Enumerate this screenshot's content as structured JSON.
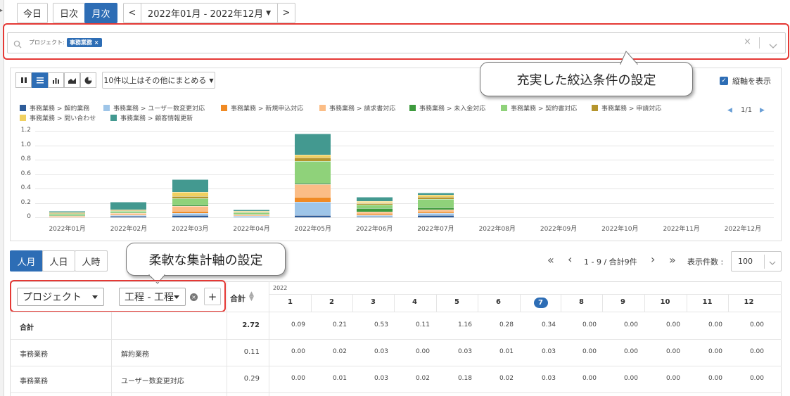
{
  "nav": {
    "today": "今日",
    "daily": "日次",
    "monthly": "月次",
    "prev": "<",
    "range": "2022年01月 - 2022年12月",
    "next": ">"
  },
  "filter": {
    "label": "プロジェクト:",
    "chip": "事務業務",
    "chip_close": "×",
    "clear": "×"
  },
  "callouts": {
    "filter": "充実した絞込条件の設定",
    "axis": "柔軟な集計軸の設定"
  },
  "toolbar": {
    "group_select": "10件以上はその他にまとめる",
    "vertical_axis": "縦軸を表示"
  },
  "legend": {
    "items": [
      {
        "label": "事務業務 > 解約業務",
        "color": "#2e5c99"
      },
      {
        "label": "事務業務 > ユーザー数変更対応",
        "color": "#9ec5e8"
      },
      {
        "label": "事務業務 > 新規申込対応",
        "color": "#f08a24"
      },
      {
        "label": "事務業務 > 請求書対応",
        "color": "#fbbd86"
      },
      {
        "label": "事務業務 > 未入金対応",
        "color": "#3d9a3d"
      },
      {
        "label": "事務業務 > 契約書対応",
        "color": "#8fd27a"
      },
      {
        "label": "事務業務 > 申請対応",
        "color": "#b5952d"
      },
      {
        "label": "事務業務 > 問い合わせ",
        "color": "#f0d060"
      },
      {
        "label": "事務業務 > 顧客情報更新",
        "color": "#439990"
      }
    ],
    "page": "1/1"
  },
  "chart_data": {
    "type": "bar",
    "stacked": true,
    "categories": [
      "2022年01月",
      "2022年02月",
      "2022年03月",
      "2022年04月",
      "2022年05月",
      "2022年06月",
      "2022年07月",
      "2022年08月",
      "2022年09月",
      "2022年10月",
      "2022年11月",
      "2022年12月"
    ],
    "yticks": [
      "1.2",
      "1.0",
      "0.8",
      "0.6",
      "0.4",
      "0.2",
      "0"
    ],
    "ylim": [
      0,
      1.2
    ],
    "series": [
      {
        "name": "事務業務 > 解約業務",
        "color": "#2e5c99",
        "values": [
          0.0,
          0.02,
          0.03,
          0.0,
          0.03,
          0.01,
          0.03,
          0,
          0,
          0,
          0,
          0
        ]
      },
      {
        "name": "事務業務 > ユーザー数変更対応",
        "color": "#9ec5e8",
        "values": [
          0.0,
          0.01,
          0.03,
          0.02,
          0.18,
          0.02,
          0.03,
          0,
          0,
          0,
          0,
          0
        ]
      },
      {
        "name": "事務業務 > 新規申込対応",
        "color": "#f08a24",
        "values": [
          0.01,
          0.01,
          0.03,
          0.01,
          0.07,
          0.02,
          0.02,
          0,
          0,
          0,
          0,
          0
        ]
      },
      {
        "name": "事務業務 > 請求書対応",
        "color": "#fbbd86",
        "values": [
          0.01,
          0.02,
          0.07,
          0.01,
          0.18,
          0.03,
          0.03,
          0,
          0,
          0,
          0,
          0
        ]
      },
      {
        "name": "事務業務 > 未入金対応",
        "color": "#3d9a3d",
        "values": [
          0.01,
          0.01,
          0.02,
          0.01,
          0.02,
          0.05,
          0.03,
          0,
          0,
          0,
          0,
          0
        ]
      },
      {
        "name": "事務業務 > 契約書対応",
        "color": "#8fd27a",
        "values": [
          0.02,
          0.02,
          0.08,
          0.02,
          0.3,
          0.05,
          0.11,
          0,
          0,
          0,
          0,
          0
        ]
      },
      {
        "name": "事務業務 > 申請対応",
        "color": "#b5952d",
        "values": [
          0.01,
          0.01,
          0.03,
          0.01,
          0.05,
          0.02,
          0.03,
          0,
          0,
          0,
          0,
          0
        ]
      },
      {
        "name": "事務業務 > 問い合わせ",
        "color": "#f0d060",
        "values": [
          0.01,
          0.01,
          0.06,
          0.01,
          0.04,
          0.02,
          0.03,
          0,
          0,
          0,
          0,
          0
        ]
      },
      {
        "name": "事務業務 > 顧客情報更新",
        "color": "#439990",
        "values": [
          0.02,
          0.1,
          0.18,
          0.02,
          0.29,
          0.06,
          0.03,
          0,
          0,
          0,
          0,
          0
        ]
      }
    ]
  },
  "units": {
    "man_month": "人月",
    "man_day": "人日",
    "man_hour": "人時"
  },
  "pager": {
    "first": "«",
    "prev": "‹",
    "info": "1 - 9 / 合計9件",
    "next": "›",
    "last": "»",
    "per_page_label": "表示件数 :",
    "per_page": "100"
  },
  "table": {
    "axis1": "プロジェクト",
    "axis2": "工程 - 工程",
    "add": "+",
    "total_header": "合計",
    "year": "2022",
    "months": [
      "1",
      "2",
      "3",
      "4",
      "5",
      "6",
      "7",
      "8",
      "9",
      "10",
      "11",
      "12"
    ],
    "rows": [
      {
        "c1": "合計",
        "c2": "",
        "total": "2.72",
        "vals": [
          "0.09",
          "0.21",
          "0.53",
          "0.11",
          "1.16",
          "0.28",
          "0.34",
          "0.00",
          "0.00",
          "0.00",
          "0.00",
          "0.00"
        ]
      },
      {
        "c1": "事務業務",
        "c2": "解約業務",
        "total": "0.11",
        "vals": [
          "0.00",
          "0.02",
          "0.03",
          "0.00",
          "0.03",
          "0.01",
          "0.03",
          "0.00",
          "0.00",
          "0.00",
          "0.00",
          "0.00"
        ]
      },
      {
        "c1": "事務業務",
        "c2": "ユーザー数変更対応",
        "total": "0.29",
        "vals": [
          "0.00",
          "0.01",
          "0.03",
          "0.02",
          "0.18",
          "0.02",
          "0.03",
          "0.00",
          "0.00",
          "0.00",
          "0.00",
          "0.00"
        ]
      }
    ]
  }
}
